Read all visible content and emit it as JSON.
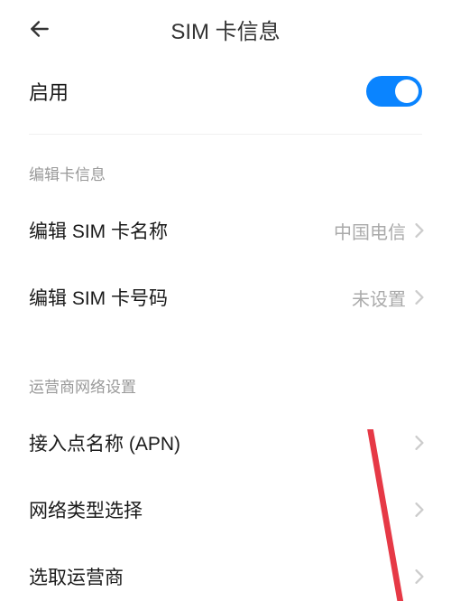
{
  "header": {
    "title": "SIM 卡信息"
  },
  "enable": {
    "label": "启用",
    "checked": true
  },
  "section1": {
    "header": "编辑卡信息",
    "items": [
      {
        "label": "编辑 SIM 卡名称",
        "value": "中国电信"
      },
      {
        "label": "编辑 SIM 卡号码",
        "value": "未设置"
      }
    ]
  },
  "section2": {
    "header": "运营商网络设置",
    "items": [
      {
        "label": "接入点名称 (APN)",
        "value": ""
      },
      {
        "label": "网络类型选择",
        "value": ""
      },
      {
        "label": "选取运营商",
        "value": ""
      }
    ]
  }
}
